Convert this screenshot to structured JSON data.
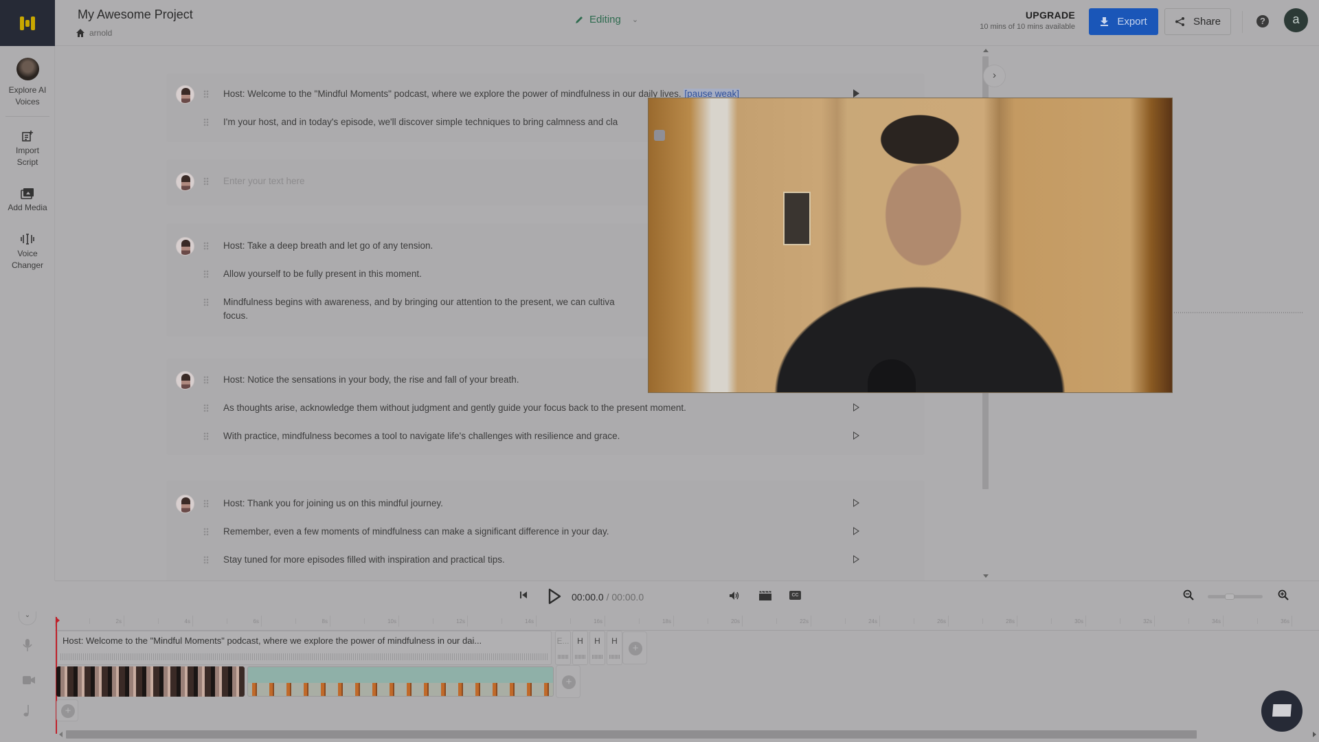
{
  "header": {
    "project_title": "My Awesome Project",
    "breadcrumb_user": "arnold",
    "mode_label": "Editing",
    "upgrade_title": "UPGRADE",
    "upgrade_sub": "10 mins of 10 mins available",
    "export_label": "Export",
    "share_label": "Share",
    "help_glyph": "?",
    "avatar_initial": "a"
  },
  "colors": {
    "brand_dark": "#262a36",
    "logo_yellow": "#c9a800",
    "export_blue": "#1a56b8",
    "editing_green": "#2e6b4f",
    "playhead_red": "#c0202a",
    "tag_blue": "#2e4f9a"
  },
  "sidebar": {
    "items": [
      {
        "label_1": "Explore AI",
        "label_2": "Voices",
        "icon": "voice-avatar"
      },
      {
        "label_1": "Import",
        "label_2": "Script",
        "icon": "import-script-icon"
      },
      {
        "label_1": "Add Media",
        "label_2": "",
        "icon": "add-media-icon"
      },
      {
        "label_1": "Voice",
        "label_2": "Changer",
        "icon": "voice-changer-icon"
      }
    ]
  },
  "script": {
    "blocks": [
      {
        "lines": [
          {
            "text": "Host: Welcome to the \"Mindful Moments\" podcast, where we explore the power of mindfulness in our daily lives.",
            "tag": "[pause weak]"
          },
          {
            "text": "I'm your host, and in today's episode, we'll discover simple techniques to bring calmness and cla"
          }
        ]
      },
      {
        "lines": [
          {
            "placeholder": "Enter your text here"
          }
        ]
      },
      {
        "lines": [
          {
            "text": "Host: Take a deep breath and let go of any tension."
          },
          {
            "text": "Allow yourself to be fully present in this moment."
          },
          {
            "text": "Mindfulness begins with awareness, and by bringing our attention to the present, we can cultiva",
            "text_cont": "focus."
          }
        ]
      },
      {
        "lines": [
          {
            "text": "Host: Notice the sensations in your body, the rise and fall of your breath."
          },
          {
            "text": "As thoughts arise, acknowledge them without judgment and gently guide your focus back to the present moment."
          },
          {
            "text": "With practice, mindfulness becomes a tool to navigate life's challenges with resilience and grace."
          }
        ]
      },
      {
        "lines": [
          {
            "text": "Host: Thank you for joining us on this mindful journey."
          },
          {
            "text": "Remember, even a few moments of mindfulness can make a significant difference in your day."
          },
          {
            "text": "Stay tuned for more episodes filled with inspiration and practical tips."
          }
        ]
      }
    ]
  },
  "player": {
    "current_time": "00:00.0",
    "separator": " / ",
    "total_time": "00:00.0",
    "cc_label": "CC",
    "zoom_level_fraction": 0.4
  },
  "timeline": {
    "ruler_labels": [
      "2s",
      "4s",
      "6s",
      "8s",
      "10s",
      "12s",
      "14s",
      "16s",
      "18s",
      "20s",
      "22s",
      "24s",
      "26s",
      "28s",
      "30s",
      "32s",
      "34s",
      "36s"
    ],
    "voice_clip_text": "Host: Welcome to the \"Mindful Moments\" podcast, where we explore the power of mindfulness in our dai...",
    "mini_clips": [
      "E...",
      "H",
      "H",
      "H"
    ],
    "add_glyph": "+",
    "collapse_glyph": "⌄"
  },
  "webcam": {
    "description": "Webcam overlay showing presenter"
  }
}
